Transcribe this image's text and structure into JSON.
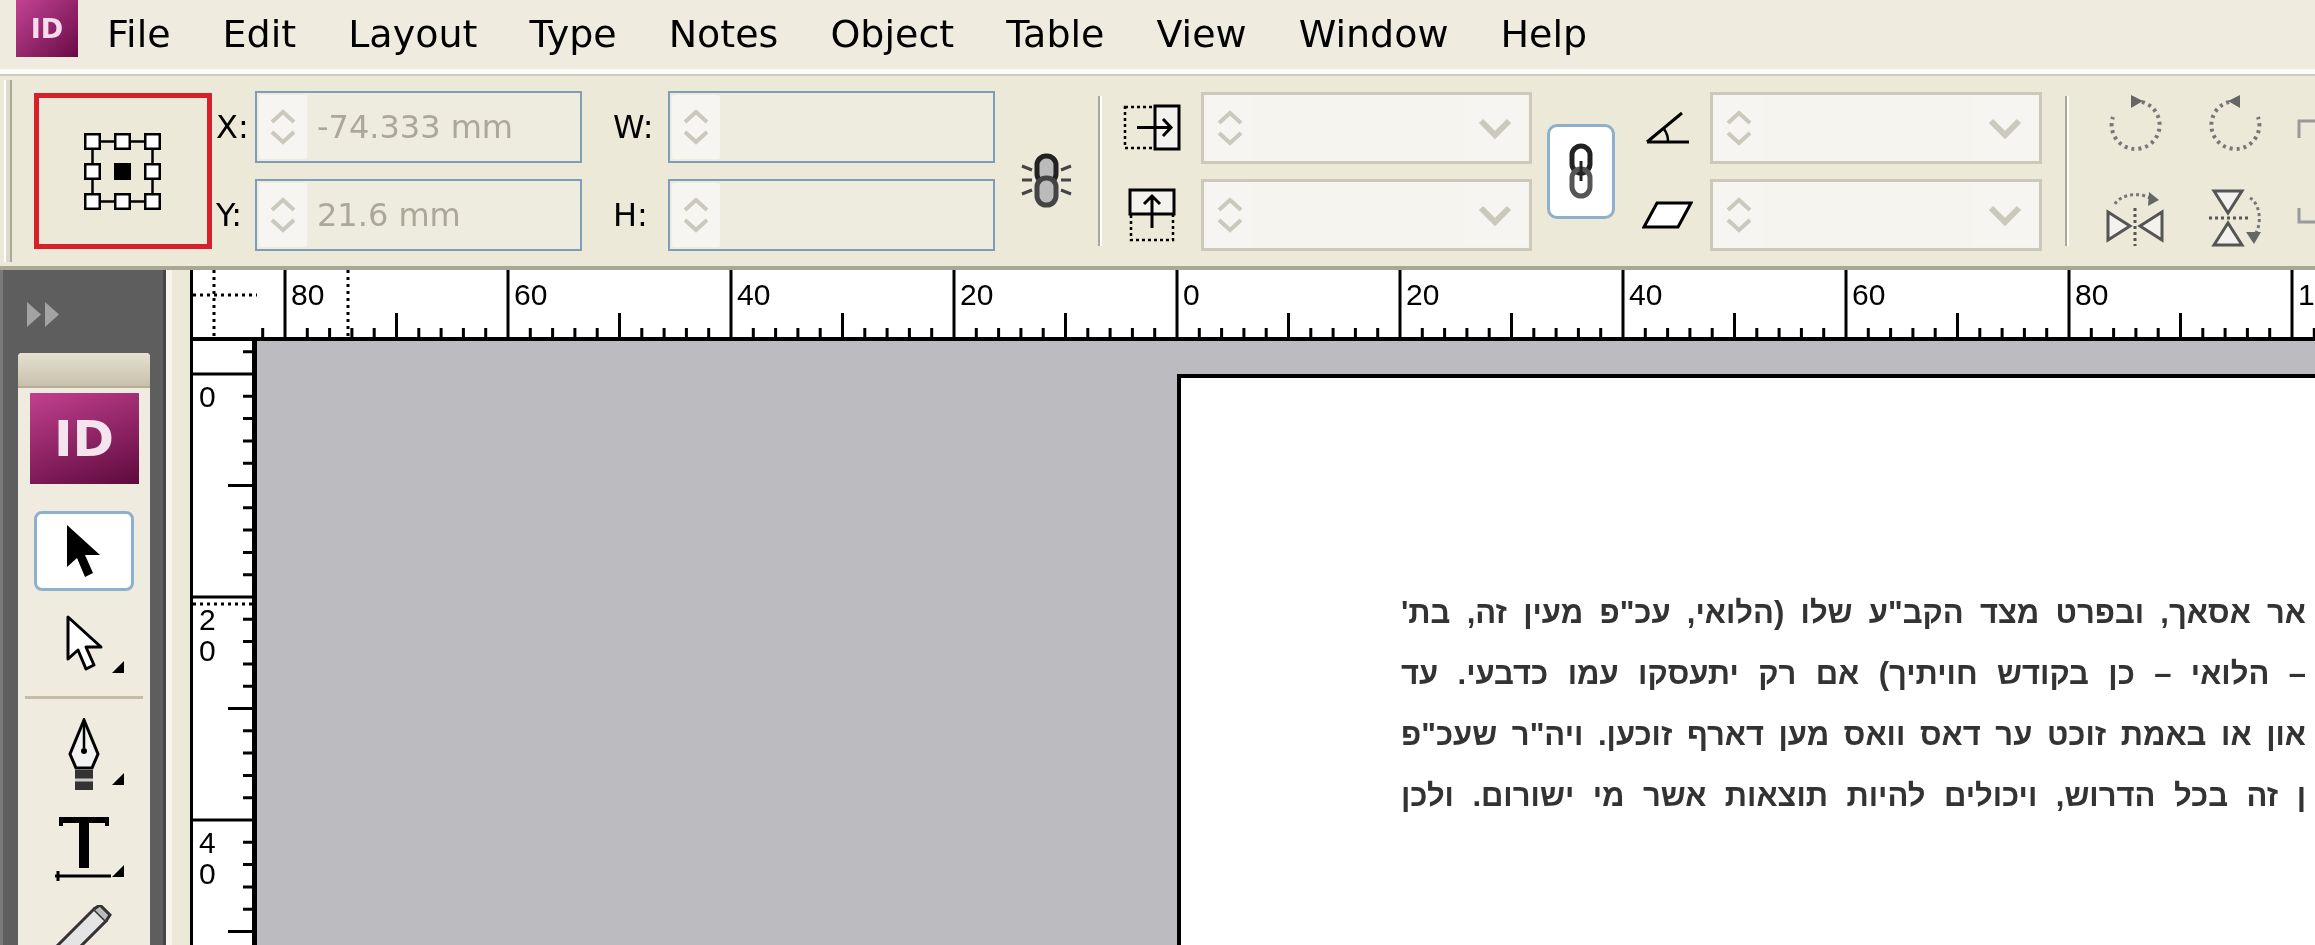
{
  "menu_bar": {
    "logo": "ID",
    "items": [
      "File",
      "Edit",
      "Layout",
      "Type",
      "Notes",
      "Object",
      "Table",
      "View",
      "Window",
      "Help"
    ]
  },
  "control_panel": {
    "reference_point": {
      "highlighted": true,
      "points": [
        {
          "selected": false
        },
        {
          "selected": false
        },
        {
          "selected": false
        },
        {
          "selected": false
        },
        {
          "selected": true
        },
        {
          "selected": false
        },
        {
          "selected": false
        },
        {
          "selected": false
        },
        {
          "selected": false
        }
      ]
    },
    "fields": [
      {
        "kind": "spin",
        "label": "X:",
        "value": "-74.333 mm",
        "disabled": true
      },
      {
        "kind": "spin",
        "label": "Y:",
        "value": "21.6 mm",
        "disabled": true
      },
      {
        "kind": "spin",
        "label": "W:",
        "disabled": true
      },
      {
        "kind": "spin",
        "label": "H:",
        "disabled": true
      },
      {
        "kind": "combo",
        "disabled": true
      },
      {
        "kind": "combo",
        "disabled": true
      },
      {
        "kind": "combo",
        "disabled": true
      },
      {
        "kind": "combo",
        "disabled": true
      }
    ]
  },
  "toolbar": {
    "logo": "ID",
    "tool_groups": [
      [
        {
          "selected": true,
          "flyout": false
        },
        {
          "selected": false,
          "flyout": true
        }
      ],
      [
        {
          "selected": false,
          "flyout": true
        },
        {
          "selected": false,
          "flyout": true
        },
        {
          "selected": false,
          "flyout": false
        }
      ]
    ]
  },
  "rulers": {
    "horizontal": [
      "80",
      "60",
      "40",
      "20",
      "0",
      "20",
      "40",
      "60",
      "80",
      "1"
    ],
    "vertical": [
      "0",
      "20",
      "40"
    ]
  },
  "document": {
    "lines": [
      "אר אסאך, ובפרט מצד הקב\"ע שלו (הלואי, עכ\"פ מעין זה, בת'",
      "– הלואי – כן בקודש חויתיך) אם רק יתעסקו עמו כדבעי. עד",
      "און או באמת זוכט ער דאס וואס מען דארף זוכען. ויה\"ר שעכ\"פ",
      "ן זה בכל הדרוש, ויכולים להיות תוצאות אשר מי ישורום. ולכן"
    ]
  }
}
